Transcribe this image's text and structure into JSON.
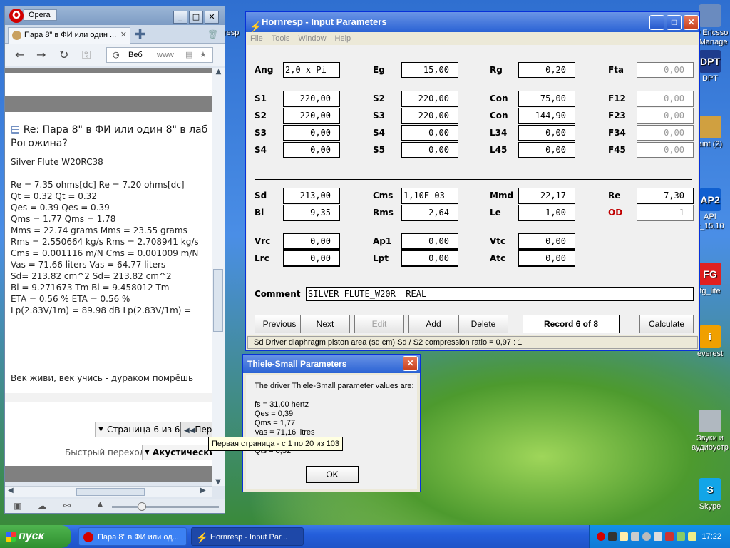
{
  "desktop_icons": [
    {
      "label": "ny Ericsso\ne Manage",
      "icon": "ericsson-icon",
      "color": "#6a8bbf",
      "glyph": ""
    },
    {
      "label": "DPT",
      "icon": "dpt-icon",
      "color": "#1e3c8c",
      "glyph": "DPT"
    },
    {
      "label": "aint (2)",
      "icon": "paint-icon",
      "color": "#d0a040",
      "glyph": ""
    },
    {
      "label": "API\nc_15.10",
      "icon": "ap2-icon",
      "color": "#1060d0",
      "glyph": "AP2"
    },
    {
      "label": "fg_lite",
      "icon": "fg-icon",
      "color": "#e02020",
      "glyph": "FG"
    },
    {
      "label": "everest",
      "icon": "everest-icon",
      "color": "#f0a000",
      "glyph": "i"
    },
    {
      "label": "Звуки и\nаудиоустр",
      "icon": "speaker-icon",
      "color": "#b0b8c0",
      "glyph": ""
    },
    {
      "label": "Skype",
      "icon": "skype-icon",
      "color": "#12a5e8",
      "glyph": "S"
    }
  ],
  "opera": {
    "title": "Opera",
    "tab_title": "Пара 8\" в ФИ или один ...",
    "addr_label": "Веб",
    "addr_text": "www",
    "post_title_1": "Re: Пара 8\" в ФИ или один 8\" в лаб",
    "post_title_2": "Рогожина?",
    "post_lines": [
      "Silver Flute W20RC38",
      "",
      "Re = 7.35 ohms[dc] Re = 7.20 ohms[dc]",
      "Qt = 0.32 Qt = 0.32",
      "Qes = 0.39 Qes = 0.39",
      "Qms = 1.77 Qms = 1.78",
      "Mms = 22.74 grams Mms = 23.55 grams",
      "Rms = 2.550664 kg/s Rms = 2.708941 kg/s",
      "Cms = 0.001116 m/N Cms = 0.001009 m/N",
      "Vas = 71.66 liters Vas = 64.77 liters",
      "Sd= 213.82 cm^2 Sd= 213.82 cm^2",
      "Bl = 9.271673 Tm Bl = 9.458012 Tm",
      "ETA = 0.56 % ETA = 0.56 %",
      "Lp(2.83V/1m) = 89.98 dB Lp(2.83V/1m) ="
    ],
    "signature": "Век живи, век учись - дураком помрёшь",
    "page_indicator": "Страница 6 из 6",
    "first_page_btn": "Пер",
    "quick_jump_label": "Быстрый переход",
    "quick_jump_value": "Акустически"
  },
  "tooltip": "Первая страница - с 1 по 20 из 103",
  "hornresp": {
    "title": "Hornresp - Input Parameters",
    "menu": [
      "File",
      "Tools",
      "Window",
      "Help"
    ],
    "fields": [
      {
        "label": "Ang",
        "value": "2,0 x Pi",
        "left": true
      },
      {
        "label": "Eg",
        "value": "15,00"
      },
      {
        "label": "Rg",
        "value": "0,20"
      },
      {
        "label": "Fta",
        "value": "0,00",
        "disabled": true
      },
      {
        "label": "S1",
        "value": "220,00"
      },
      {
        "label": "S2",
        "value": "220,00"
      },
      {
        "label": "Con",
        "value": "75,00"
      },
      {
        "label": "F12",
        "value": "0,00",
        "disabled": true
      },
      {
        "label": "S2",
        "value": "220,00"
      },
      {
        "label": "S3",
        "value": "220,00"
      },
      {
        "label": "Con",
        "value": "144,90"
      },
      {
        "label": "F23",
        "value": "0,00",
        "disabled": true
      },
      {
        "label": "S3",
        "value": "0,00"
      },
      {
        "label": "S4",
        "value": "0,00"
      },
      {
        "label": "L34",
        "value": "0,00"
      },
      {
        "label": "F34",
        "value": "0,00",
        "disabled": true
      },
      {
        "label": "S4",
        "value": "0,00"
      },
      {
        "label": "S5",
        "value": "0,00"
      },
      {
        "label": "L45",
        "value": "0,00"
      },
      {
        "label": "F45",
        "value": "0,00",
        "disabled": true
      },
      {
        "label": "Sd",
        "value": "213,00"
      },
      {
        "label": "Cms",
        "value": "1,10E-03",
        "left": true
      },
      {
        "label": "Mmd",
        "value": "22,17"
      },
      {
        "label": "Re",
        "value": "7,30"
      },
      {
        "label": "Bl",
        "value": "9,35"
      },
      {
        "label": "Rms",
        "value": "2,64"
      },
      {
        "label": "Le",
        "value": "1,00"
      },
      {
        "label": "OD",
        "value": "1",
        "disabled": true,
        "red": true
      },
      {
        "label": "Vrc",
        "value": "0,00"
      },
      {
        "label": "Ap1",
        "value": "0,00"
      },
      {
        "label": "Vtc",
        "value": "0,00"
      },
      {
        "label": "Lrc",
        "value": "0,00"
      },
      {
        "label": "Lpt",
        "value": "0,00"
      },
      {
        "label": "Atc",
        "value": "0,00"
      }
    ],
    "comment_label": "Comment",
    "comment_value": "SILVER FLUTE_W20R  REAL",
    "buttons": {
      "previous": "Previous",
      "next": "Next",
      "edit": "Edit",
      "add": "Add",
      "delete": "Delete",
      "calculate": "Calculate"
    },
    "record": "Record 6 of 8",
    "status": "Sd   Driver diaphragm piston area  (sq cm)   Sd / S2 compression ratio = 0,97 : 1"
  },
  "thiele_small": {
    "title": "Thiele-Small Parameters",
    "intro": "The driver Thiele-Small parameter values are:",
    "lines": [
      "fs = 31,00 hertz",
      "Qes = 0,39",
      "Qms = 1,77",
      "Vas = 71,16 litres",
      "",
      "Qts = 0,32"
    ],
    "ok": "OK"
  },
  "taskbar": {
    "start": "пуск",
    "tasks": [
      {
        "label": "Пара 8\" в ФИ или од...",
        "icon": "opera-icon"
      },
      {
        "label": "Hornresp - Input Par...",
        "icon": "hornresp-icon"
      }
    ],
    "clock": "17:22"
  }
}
